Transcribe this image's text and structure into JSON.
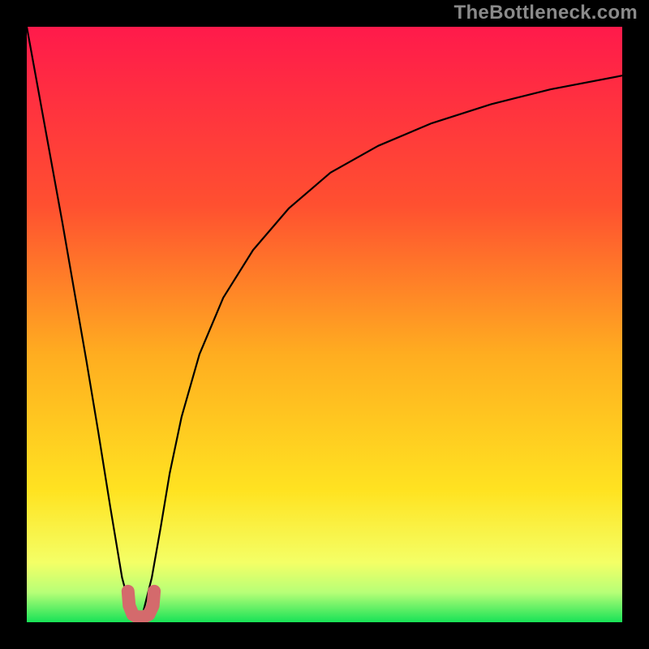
{
  "watermark": "TheBottleneck.com",
  "colors": {
    "frame": "#000000",
    "grad_top": "#ff1a4b",
    "grad_30": "#ff5030",
    "grad_55": "#ffad20",
    "grad_75": "#ffe321",
    "grad_90": "#f4ff66",
    "grad_95": "#b7ff77",
    "grad_bottom": "#18e257",
    "curve": "#000000",
    "notch": "#d46a6c"
  },
  "chart_data": {
    "type": "line",
    "title": "",
    "xlabel": "",
    "ylabel": "",
    "xlim": [
      0,
      1
    ],
    "ylim": [
      0,
      1
    ],
    "series": [
      {
        "name": "bottleneck-curve",
        "x": [
          0.0,
          0.02,
          0.04,
          0.06,
          0.08,
          0.1,
          0.12,
          0.14,
          0.16,
          0.176,
          0.185,
          0.195,
          0.21,
          0.225,
          0.24,
          0.26,
          0.29,
          0.33,
          0.38,
          0.44,
          0.51,
          0.59,
          0.68,
          0.78,
          0.88,
          1.0
        ],
        "y": [
          1.0,
          0.89,
          0.78,
          0.67,
          0.555,
          0.44,
          0.32,
          0.195,
          0.075,
          0.015,
          0.01,
          0.015,
          0.075,
          0.16,
          0.25,
          0.345,
          0.45,
          0.545,
          0.625,
          0.695,
          0.755,
          0.8,
          0.838,
          0.87,
          0.895,
          0.918
        ]
      },
      {
        "name": "notch",
        "x": [
          0.17,
          0.172,
          0.178,
          0.185,
          0.197,
          0.205,
          0.212,
          0.214
        ],
        "y": [
          0.052,
          0.028,
          0.013,
          0.009,
          0.009,
          0.013,
          0.028,
          0.052
        ]
      }
    ]
  }
}
